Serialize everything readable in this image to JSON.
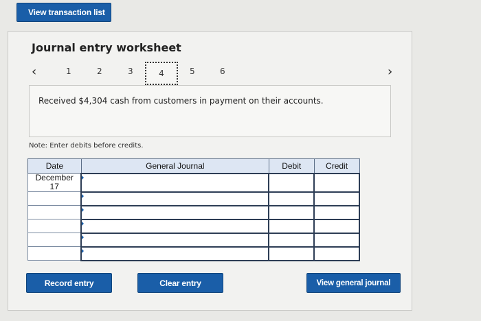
{
  "header": {
    "view_transaction_list": "View transaction list"
  },
  "worksheet": {
    "title": "Journal entry worksheet",
    "pager": {
      "prev_icon": "chevron-left-icon",
      "next_icon": "chevron-right-icon",
      "pages": [
        "1",
        "2",
        "3",
        "4",
        "5",
        "6"
      ],
      "active_page": "4"
    },
    "description": "Received $4,304 cash from customers in payment on their accounts.",
    "note": "Note: Enter debits before credits."
  },
  "journal_table": {
    "headers": {
      "date": "Date",
      "general_journal": "General Journal",
      "debit": "Debit",
      "credit": "Credit"
    },
    "first_row_date_line1": "December",
    "first_row_date_line2": "17"
  },
  "actions": {
    "record_entry": "Record entry",
    "clear_entry": "Clear entry",
    "view_general_journal": "View general journal"
  },
  "colors": {
    "button_blue": "#1a5ea8",
    "table_header_bg": "#dde6f3",
    "background": "#e9e9e6"
  }
}
